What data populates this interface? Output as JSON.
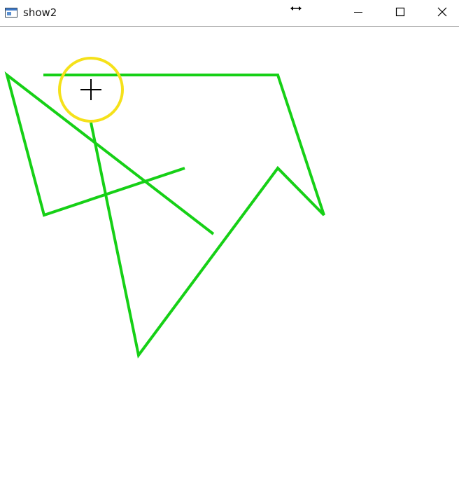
{
  "window": {
    "title": "show2",
    "app_icon": "window-app-icon",
    "resize_indicator_icon": "horizontal-resize-arrow-icon",
    "controls": {
      "minimize_icon": "minimize-icon",
      "maximize_icon": "maximize-icon",
      "close_icon": "close-icon"
    }
  },
  "canvas": {
    "polyline_color": "#16d016",
    "cursor_highlight_color": "#f5e11a",
    "cursor_icon": "crosshair-cursor-icon"
  }
}
